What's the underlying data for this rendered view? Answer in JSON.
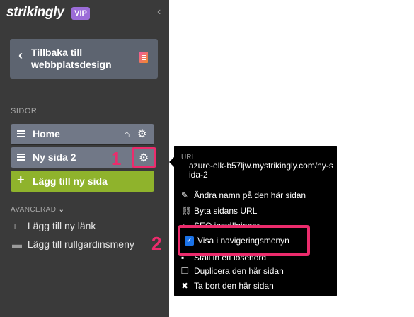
{
  "brand": {
    "logo": "strikingly",
    "badge": "VIP"
  },
  "sidebar": {
    "back_label": "Tillbaka till\nwebbplatsdesign",
    "section_title": "SIDOR",
    "pages": [
      {
        "label": "Home"
      },
      {
        "label": "Ny sida 2"
      }
    ],
    "add_page_label": "Lägg till ny sida",
    "advanced_label": "AVANCERAD",
    "advanced_items": [
      {
        "label": "Lägg till ny länk"
      },
      {
        "label": "Lägg till rullgardinsmeny"
      }
    ]
  },
  "callouts": {
    "one": "1",
    "two": "2"
  },
  "popup": {
    "url_label": "URL",
    "url_value": "azure-elk-b57ljw.mystrikingly.com/ny-sida-2",
    "items": {
      "rename": "Ändra namn på den här sidan",
      "change_url": "Byta sidans URL",
      "seo": "SEO inställningar",
      "show_in_nav": "Visa i navigeringsmenyn",
      "password": "Ställ in ett lösenord",
      "duplicate": "Duplicera den här sidan",
      "delete": "Ta bort den här sidan"
    },
    "show_in_nav_checked": true
  },
  "colors": {
    "sidebar_bg": "#3a3a3a",
    "page_item": "#717887",
    "add_button": "#8fb32c",
    "highlight": "#ec2b6c",
    "vip": "#9b6cd8"
  }
}
